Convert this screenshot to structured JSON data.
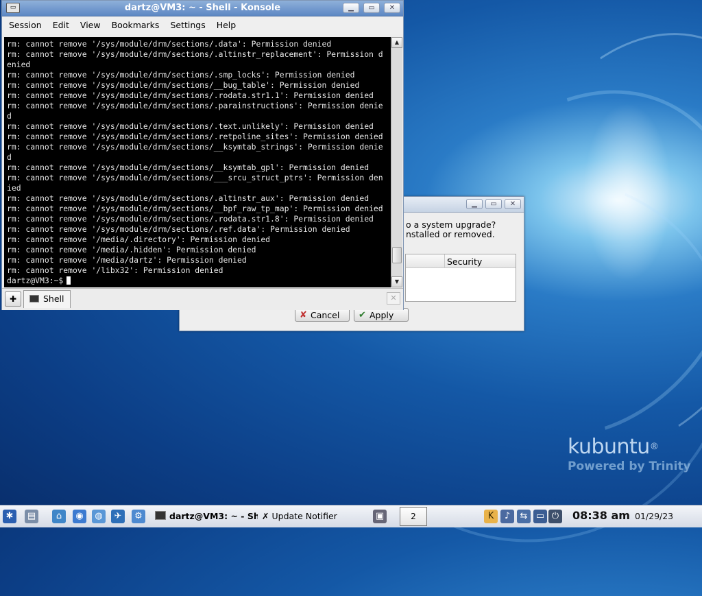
{
  "konsole": {
    "title": "dartz@VM3: ~ - Shell - Konsole",
    "window_buttons": [
      "▁",
      "▭",
      "✕"
    ],
    "menu": [
      "Session",
      "Edit",
      "View",
      "Bookmarks",
      "Settings",
      "Help"
    ],
    "terminal_lines": [
      "rm: cannot remove '/sys/module/drm/sections/.data': Permission denied",
      "rm: cannot remove '/sys/module/drm/sections/.altinstr_replacement': Permission d",
      "enied",
      "rm: cannot remove '/sys/module/drm/sections/.smp_locks': Permission denied",
      "rm: cannot remove '/sys/module/drm/sections/__bug_table': Permission denied",
      "rm: cannot remove '/sys/module/drm/sections/.rodata.str1.1': Permission denied",
      "rm: cannot remove '/sys/module/drm/sections/.parainstructions': Permission denie",
      "d",
      "rm: cannot remove '/sys/module/drm/sections/.text.unlikely': Permission denied",
      "rm: cannot remove '/sys/module/drm/sections/.retpoline_sites': Permission denied",
      "rm: cannot remove '/sys/module/drm/sections/__ksymtab_strings': Permission denie",
      "d",
      "rm: cannot remove '/sys/module/drm/sections/__ksymtab_gpl': Permission denied",
      "rm: cannot remove '/sys/module/drm/sections/___srcu_struct_ptrs': Permission den",
      "ied",
      "rm: cannot remove '/sys/module/drm/sections/.altinstr_aux': Permission denied",
      "rm: cannot remove '/sys/module/drm/sections/__bpf_raw_tp_map': Permission denied",
      "rm: cannot remove '/sys/module/drm/sections/.rodata.str1.8': Permission denied",
      "rm: cannot remove '/sys/module/drm/sections/.ref.data': Permission denied",
      "rm: cannot remove '/media/.directory': Permission denied",
      "rm: cannot remove '/media/.hidden': Permission denied",
      "rm: cannot remove '/media/dartz': Permission denied",
      "rm: cannot remove '/libx32': Permission denied"
    ],
    "prompt": "dartz@VM3:~$",
    "tab_label": "Shell"
  },
  "notifier": {
    "question_line1": "o a system upgrade?",
    "question_line2": "nstalled or removed.",
    "column_header": "Security",
    "cancel_label": "Cancel",
    "apply_label": "Apply"
  },
  "desktop": {
    "brand": "kubuntu",
    "brand_mark": "®",
    "tagline": "Powered by Trinity"
  },
  "taskbar": {
    "tasks": [
      "dartz@VM3: ~ - Sh",
      "Update Notifier"
    ],
    "pager": "2",
    "time": "08:38 am",
    "date": "01/29/23"
  }
}
